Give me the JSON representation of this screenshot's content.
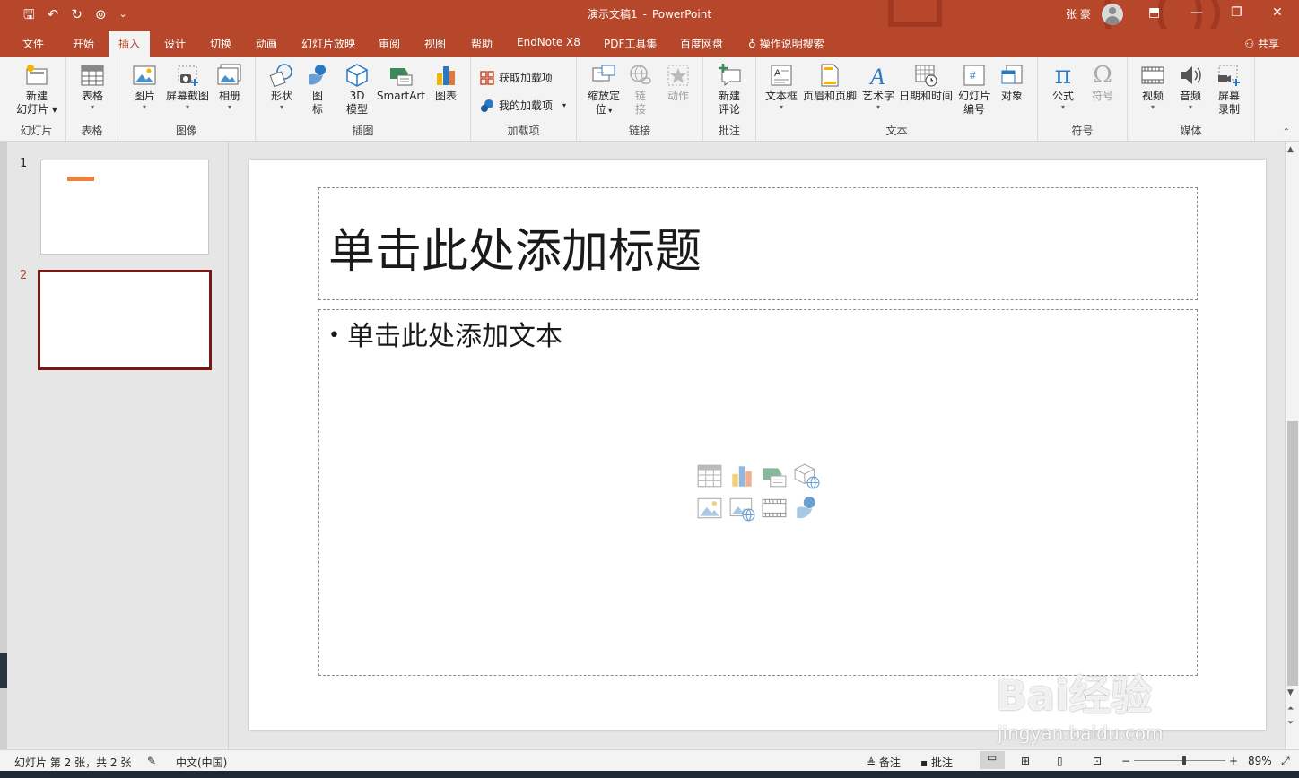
{
  "titlebar": {
    "doc_name": "演示文稿1",
    "separator": "-",
    "app_name": "PowerPoint",
    "user": "张 豪",
    "qat": {
      "save": "🖫",
      "undo": "↶",
      "redo": "↻",
      "present": "⊚",
      "more": "⌄"
    },
    "controls": {
      "ribbon_display": "⬒",
      "minimize": "—",
      "restore": "❐",
      "close": "✕"
    }
  },
  "tabs": [
    {
      "label": "文件"
    },
    {
      "label": "开始"
    },
    {
      "label": "插入"
    },
    {
      "label": "设计"
    },
    {
      "label": "切换"
    },
    {
      "label": "动画"
    },
    {
      "label": "幻灯片放映"
    },
    {
      "label": "审阅"
    },
    {
      "label": "视图"
    },
    {
      "label": "帮助"
    },
    {
      "label": "EndNote X8"
    },
    {
      "label": "PDF工具集"
    },
    {
      "label": "百度网盘"
    },
    {
      "label": "操作说明搜索"
    }
  ],
  "active_tab": "插入",
  "share_label": "共享",
  "ribbon": {
    "groups": {
      "slides": "幻灯片",
      "table": "表格",
      "images": "图像",
      "illustrations": "插图",
      "addins": "加载项",
      "links": "链接",
      "comments": "批注",
      "text": "文本",
      "symbols": "符号",
      "media": "媒体"
    },
    "buttons": {
      "new_slide_1": "新建",
      "new_slide_2": "幻灯片",
      "table": "表格",
      "picture": "图片",
      "screenshot": "屏幕截图",
      "album": "相册",
      "shapes": "形状",
      "icons_1": "图",
      "icons_2": "标",
      "model3d_1": "3D",
      "model3d_2": "模型",
      "smartart": "SmartArt",
      "chart": "图表",
      "get_addins": "获取加载项",
      "my_addins": "我的加载项",
      "zoom_1": "缩放定",
      "zoom_2": "位",
      "link_1": "链",
      "link_2": "接",
      "action": "动作",
      "comment_1": "新建",
      "comment_2": "评论",
      "textbox": "文本框",
      "header_footer": "页眉和页脚",
      "wordart": "艺术字",
      "datetime": "日期和时间",
      "slidenum_1": "幻灯片",
      "slidenum_2": "编号",
      "object": "对象",
      "equation": "公式",
      "symbol": "符号",
      "video": "视频",
      "audio": "音频",
      "screenrec_1": "屏幕",
      "screenrec_2": "录制"
    }
  },
  "thumbnails": [
    {
      "number": "1"
    },
    {
      "number": "2"
    }
  ],
  "slide": {
    "title_placeholder": "单击此处添加标题",
    "body_placeholder": "单击此处添加文本",
    "bullet": "•"
  },
  "status": {
    "slide_info": "幻灯片 第 2 张，共 2 张",
    "language": "中文(中国)",
    "notes": "备注",
    "comments": "批注",
    "zoom": "89%",
    "zoom_level": 0.55
  },
  "watermark": {
    "brand": "Bai经验",
    "url": "jingyan.baidu.com"
  },
  "colors": {
    "accent": "#b7472a",
    "selected_border": "#7a1818",
    "ribbon_bg": "#f3f3f3"
  }
}
